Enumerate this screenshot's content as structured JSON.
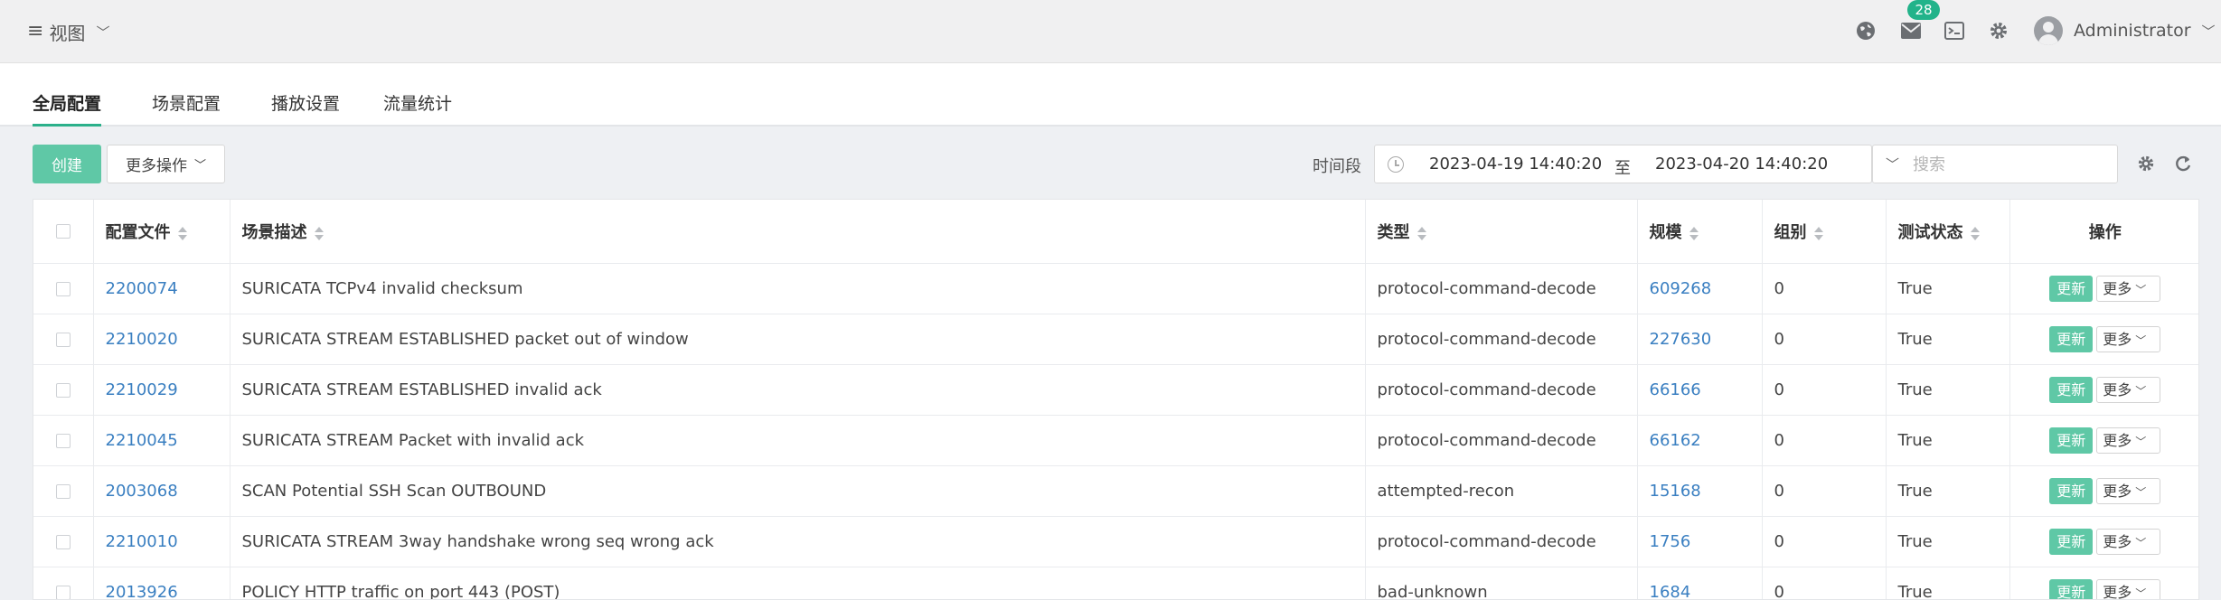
{
  "header": {
    "view_label": "视图",
    "badge_count": "28",
    "user_name": "Administrator",
    "icons": [
      "globe-icon",
      "mail-icon",
      "terminal-icon",
      "gear-icon",
      "user-avatar"
    ]
  },
  "tabs": [
    {
      "label": "全局配置",
      "active": true
    },
    {
      "label": "场景配置",
      "active": false
    },
    {
      "label": "播放设置",
      "active": false
    },
    {
      "label": "流量统计",
      "active": false
    }
  ],
  "toolbar": {
    "create_label": "创建",
    "more_label": "更多操作",
    "time_label": "时间段",
    "date_start": "2023-04-19 14:40:20",
    "date_sep": "至",
    "date_end": "2023-04-20 14:40:20",
    "search_placeholder": "搜索"
  },
  "table": {
    "columns": [
      "配置文件",
      "场景描述",
      "类型",
      "规模",
      "组别",
      "测试状态",
      "操作"
    ],
    "update_label": "更新",
    "more_label": "更多",
    "rows": [
      {
        "id": "2200074",
        "desc": "SURICATA TCPv4 invalid checksum",
        "type": "protocol-command-decode",
        "scale": "609268",
        "group": "0",
        "status": "True"
      },
      {
        "id": "2210020",
        "desc": "SURICATA STREAM ESTABLISHED packet out of window",
        "type": "protocol-command-decode",
        "scale": "227630",
        "group": "0",
        "status": "True"
      },
      {
        "id": "2210029",
        "desc": "SURICATA STREAM ESTABLISHED invalid ack",
        "type": "protocol-command-decode",
        "scale": "66166",
        "group": "0",
        "status": "True"
      },
      {
        "id": "2210045",
        "desc": "SURICATA STREAM Packet with invalid ack",
        "type": "protocol-command-decode",
        "scale": "66162",
        "group": "0",
        "status": "True"
      },
      {
        "id": "2003068",
        "desc": "SCAN Potential SSH Scan OUTBOUND",
        "type": "attempted-recon",
        "scale": "15168",
        "group": "0",
        "status": "True"
      },
      {
        "id": "2210010",
        "desc": "SURICATA STREAM 3way handshake wrong seq wrong ack",
        "type": "protocol-command-decode",
        "scale": "1756",
        "group": "0",
        "status": "True"
      },
      {
        "id": "2013926",
        "desc": "POLICY HTTP traffic on port 443 (POST)",
        "type": "bad-unknown",
        "scale": "1684",
        "group": "0",
        "status": "True"
      }
    ]
  }
}
